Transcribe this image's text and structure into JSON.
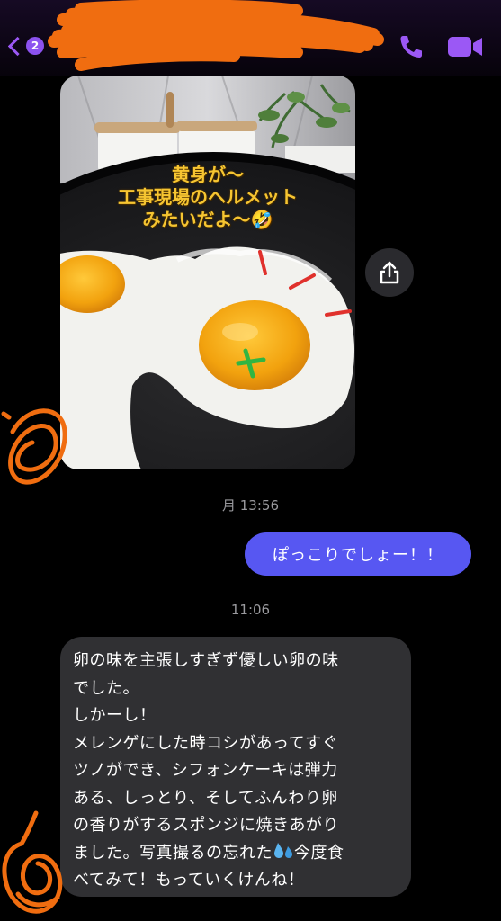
{
  "header": {
    "back_badge": "2",
    "contact_name": "",
    "contact_subtitle": "",
    "back_icon": "chevron-left-icon",
    "call_icon": "phone-icon",
    "video_icon": "video-camera-icon",
    "accent_color": "#9b58f5"
  },
  "conversation": {
    "photo": {
      "caption_lines": [
        "黄身が〜",
        "工事現場のヘルメット",
        "みたいだよ〜🤣"
      ],
      "caption_color": "#f6c531",
      "share_icon": "share-icon"
    },
    "timestamp_1": "月 13:56",
    "outgoing_message": "ぽっこりでしょー！！",
    "outgoing_bubble_color": "#5757f2",
    "timestamp_2": "11:06",
    "incoming_message": {
      "lines": [
        "卵の味を主張しすぎず優しい卵の味",
        "でした。",
        "しかーし！",
        "メレンゲにした時コシがあってすぐ",
        "ツノができ、シフォンケーキは弾力",
        "ある、しっとり、そしてふんわり卵",
        "の香りがするスポンジに焼きあがり",
        "ました。写真撮るの忘れた",
        "今度食",
        "べてみて！もっていくけんね！"
      ],
      "emoji_icon": "sweat-droplets-icon",
      "bubble_color": "#303033"
    }
  }
}
